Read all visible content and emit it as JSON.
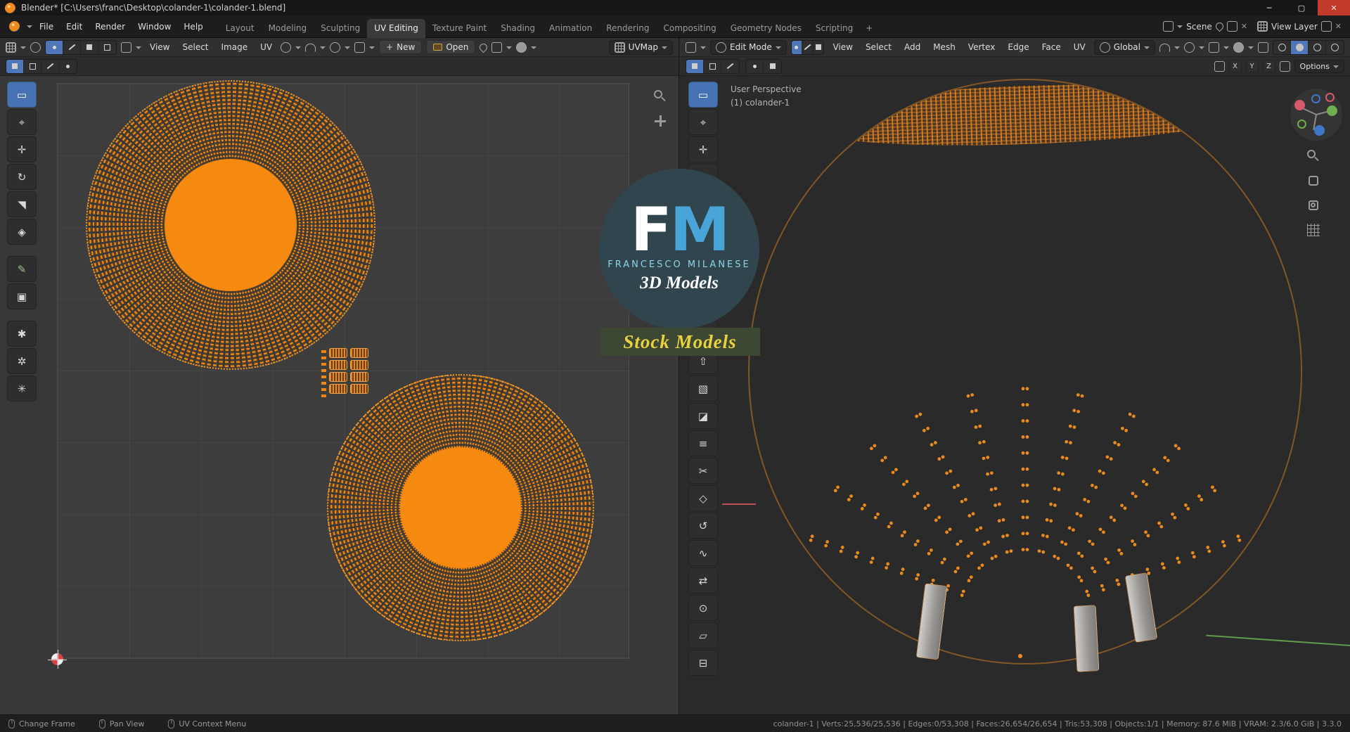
{
  "window": {
    "title": "Blender* [C:\\Users\\franc\\Desktop\\colander-1\\colander-1.blend]",
    "minimize_glyph": "─",
    "maximize_glyph": "▢",
    "close_glyph": "✕"
  },
  "topbar": {
    "menus": [
      "File",
      "Edit",
      "Render",
      "Window",
      "Help"
    ],
    "workspaces": [
      "Layout",
      "Modeling",
      "Sculpting",
      "UV Editing",
      "Texture Paint",
      "Shading",
      "Animation",
      "Rendering",
      "Compositing",
      "Geometry Nodes",
      "Scripting"
    ],
    "active_workspace": "UV Editing",
    "add_workspace": "+",
    "scene_selector": {
      "label": "Scene",
      "close_glyph": "✕"
    },
    "view_layer_selector": {
      "label": "View Layer",
      "close_glyph": "✕"
    }
  },
  "uv_editor": {
    "menus": [
      "View",
      "Select",
      "Image",
      "UV"
    ],
    "new_button": "New",
    "new_plus": "+",
    "open_button": "Open",
    "uv_map": "UVMap",
    "tools": [
      {
        "name": "tweak-select",
        "glyph": "▭",
        "active": true
      },
      {
        "name": "cursor",
        "glyph": "⌖"
      },
      {
        "name": "move",
        "glyph": "✛"
      },
      {
        "name": "rotate",
        "glyph": "↻"
      },
      {
        "name": "scale",
        "glyph": "◥"
      },
      {
        "name": "transform",
        "glyph": "◈"
      },
      {
        "gap": true
      },
      {
        "name": "annotate",
        "glyph": "✎",
        "tint": "#9ec183"
      },
      {
        "name": "measure",
        "glyph": "▣"
      },
      {
        "gap": true
      },
      {
        "name": "grab",
        "glyph": "✱"
      },
      {
        "name": "relax",
        "glyph": "✲"
      },
      {
        "name": "pinch",
        "glyph": "✳"
      }
    ]
  },
  "viewport": {
    "mode": "Edit Mode",
    "menus": [
      "View",
      "Select",
      "Add",
      "Mesh",
      "Vertex",
      "Edge",
      "Face",
      "UV"
    ],
    "orientation": "Global",
    "options_label": "Options",
    "overlay": {
      "line1": "User Perspective",
      "line2": "(1) colander-1"
    },
    "mirror_axes": [
      "X",
      "Y",
      "Z"
    ],
    "tools": [
      {
        "name": "select-box",
        "glyph": "▭",
        "active": true
      },
      {
        "name": "cursor",
        "glyph": "⌖"
      },
      {
        "name": "move",
        "glyph": "✛"
      },
      {
        "name": "rotate",
        "glyph": "↻"
      },
      {
        "name": "scale",
        "glyph": "◥"
      },
      {
        "name": "transform",
        "glyph": "◈"
      },
      {
        "gap": true
      },
      {
        "name": "annotate",
        "glyph": "✎",
        "tint": "#9ec183"
      },
      {
        "name": "measure",
        "glyph": "∠"
      },
      {
        "gap": true
      },
      {
        "name": "add-cube",
        "glyph": "▦"
      },
      {
        "name": "extrude-region",
        "glyph": "⇧"
      },
      {
        "name": "inset-faces",
        "glyph": "▧"
      },
      {
        "name": "bevel",
        "glyph": "◪"
      },
      {
        "name": "loop-cut",
        "glyph": "≡"
      },
      {
        "name": "knife",
        "glyph": "✂"
      },
      {
        "name": "poly-build",
        "glyph": "◇"
      },
      {
        "name": "spin",
        "glyph": "↺"
      },
      {
        "name": "smooth",
        "glyph": "∿"
      },
      {
        "name": "edge-slide",
        "glyph": "⇄"
      },
      {
        "name": "shrink-fatten",
        "glyph": "⊙"
      },
      {
        "name": "shear",
        "glyph": "▱"
      },
      {
        "name": "rip-region",
        "glyph": "⊟"
      }
    ]
  },
  "watermark": {
    "f": "F",
    "m": "M",
    "name": "FRANCESCO MILANESE",
    "models": "3D Models",
    "banner": "Stock Models"
  },
  "statusbar": {
    "hints": [
      "Change Frame",
      "Pan View",
      "UV Context Menu"
    ],
    "stats": "colander-1 | Verts:25,536/25,536 | Edges:0/53,308 | Faces:26,654/26,654 | Tris:53,308 | Objects:1/1 | Memory: 87.6 MiB | VRAM: 2.3/6.0 GiB | 3.3.0"
  },
  "colors": {
    "accent_orange": "#f5870f",
    "tool_active_blue": "#4772b3",
    "mesh_orange": "#e98a1e",
    "watermark_teal": "#31454f",
    "watermark_yellow": "#e8d23e"
  }
}
